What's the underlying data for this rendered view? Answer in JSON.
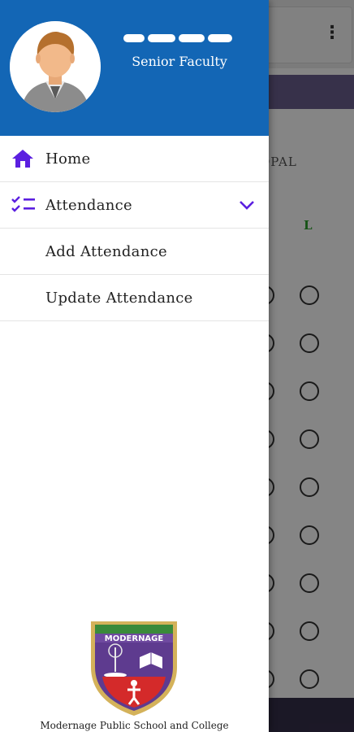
{
  "background": {
    "student_name_fragment": "OPAL",
    "column_label": "L",
    "colors": {
      "accent_band": "#6a5f8f",
      "present_green": "#2aa02a",
      "bottom_bar": "#352e4a"
    }
  },
  "drawer": {
    "header": {
      "user_name": "",
      "user_role": "Senior Faculty",
      "avatar": "user-avatar-icon"
    },
    "menu": {
      "home_label": "Home",
      "attendance_label": "Attendance",
      "add_attendance_label": "Add Attendance",
      "update_attendance_label": "Update Attendance"
    },
    "footer": {
      "school_name": "Modernage Public School and College",
      "logo_text": "MODERNAGE",
      "logo_icon": "school-crest-icon"
    },
    "colors": {
      "header_bg": "#1366b5",
      "icon_accent": "#5b1fe0"
    }
  }
}
